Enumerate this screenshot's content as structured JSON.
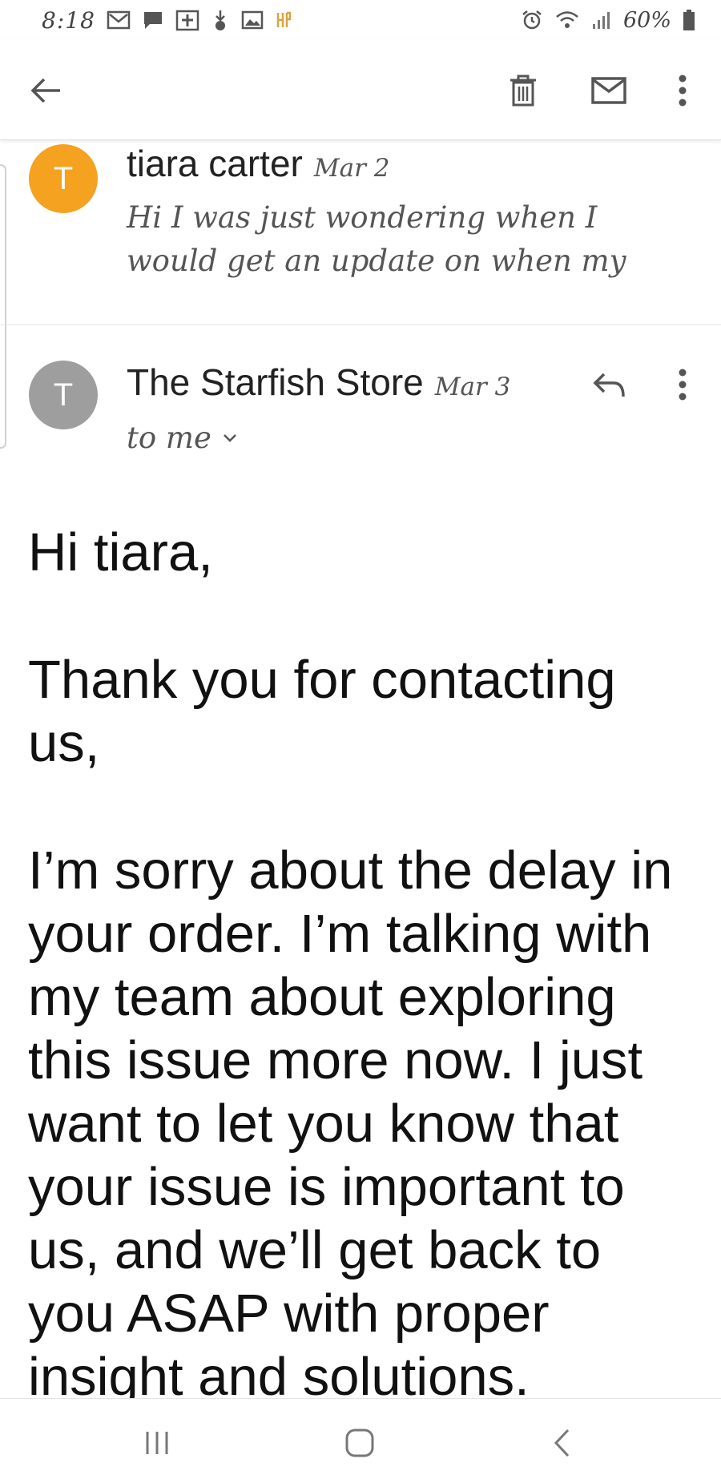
{
  "status_bar": {
    "time": "8:18",
    "battery": "60%",
    "notif_icons": [
      "gmail-icon",
      "message-icon",
      "calendar-icon",
      "download-icon",
      "image-icon",
      "hp-icon"
    ],
    "status_icons": [
      "alarm-icon",
      "wifi-icon",
      "signal-icon",
      "battery-icon"
    ]
  },
  "toolbar": {
    "back_icon": "arrow-left-icon",
    "delete_icon": "trash-icon",
    "mark_unread_icon": "mail-icon",
    "more_icon": "more-vert-icon"
  },
  "messages": [
    {
      "avatar_letter": "T",
      "avatar_color": "#F4A21F",
      "sender": "tiara carter",
      "date": "Mar 2",
      "snippet": "Hi I was just wondering when I would get an update on when my"
    },
    {
      "avatar_letter": "T",
      "avatar_color": "#9E9E9E",
      "sender": "The Starfish Store",
      "date": "Mar 3",
      "recipient": "to me"
    }
  ],
  "email_body": {
    "paragraphs": [
      "Hi tiara,",
      "Thank you for contacting us,",
      "I’m sorry about the delay in your order. I’m talking with my team about exploring this issue more now. I just want to let you know that your issue is important to us, and we’ll get back to you ASAP with proper insight and solutions."
    ]
  },
  "nav_bar": {
    "recents_icon": "recents-icon",
    "home_icon": "home-icon",
    "back_icon": "back-chevron-icon"
  }
}
